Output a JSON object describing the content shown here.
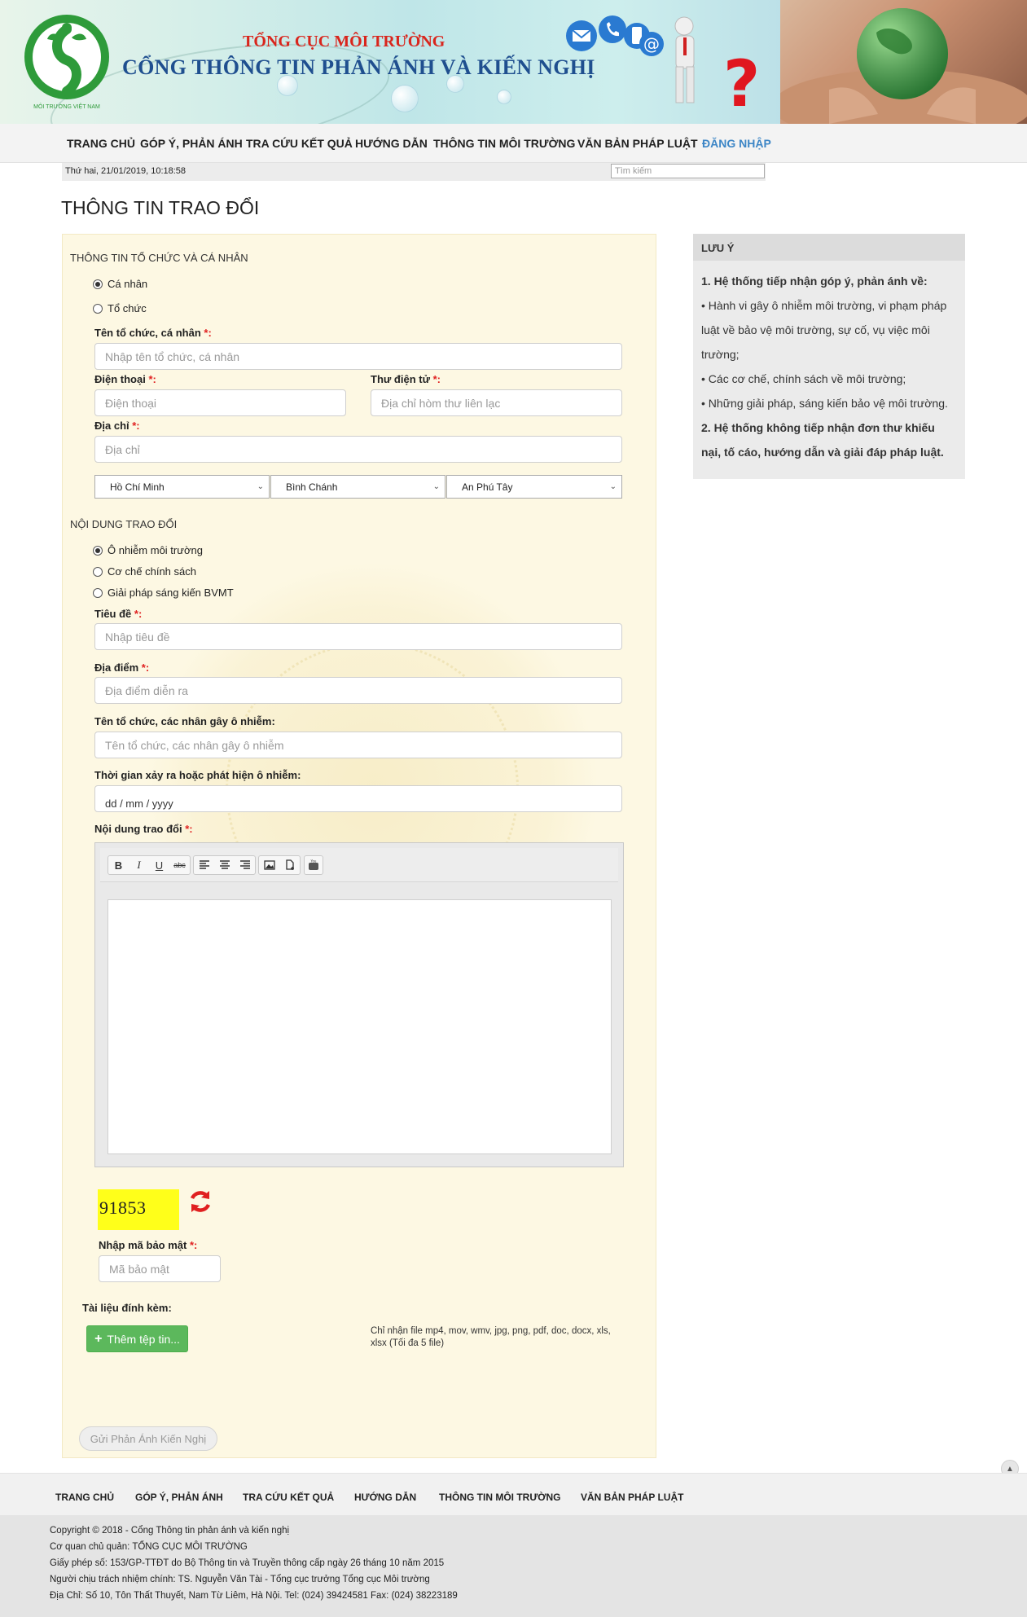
{
  "header": {
    "agency": "TỔNG CỤC MÔI TRƯỜNG",
    "portal_title": "CỔNG THÔNG TIN PHẢN ÁNH VÀ KIẾN NGHỊ",
    "logo_caption": "MÔI TRƯỜNG VIỆT NAM"
  },
  "nav": {
    "items": [
      "TRANG CHỦ",
      "GÓP Ý, PHẢN ÁNH",
      "TRA CỨU KẾT QUẢ",
      "HƯỚNG DẪN",
      "THÔNG TIN MÔI TRƯỜNG",
      "VĂN BẢN PHÁP LUẬT",
      "ĐĂNG NHẬP"
    ]
  },
  "datebar": {
    "date": "Thứ hai, 21/01/2019, 10:18:58",
    "search_placeholder": "Tìm kiếm"
  },
  "page_title": "THÔNG TIN TRAO ĐỔI",
  "form": {
    "section1": "THÔNG TIN TỔ CHỨC VÀ CÁ NHÂN",
    "type_options": [
      {
        "label": "Cá nhân",
        "selected": true
      },
      {
        "label": "Tổ chức",
        "selected": false
      }
    ],
    "name_label": "Tên tổ chức, cá nhân ",
    "name_placeholder": "Nhập tên tổ chức, cá nhân",
    "phone_label": "Điện thoại ",
    "phone_placeholder": "Điện thoại",
    "email_label": "Thư điện tử ",
    "email_placeholder": "Địa chỉ hòm thư liên lạc",
    "address_label": "Địa chỉ ",
    "address_placeholder": "Địa chỉ",
    "province": "Hồ Chí Minh",
    "district": "Bình Chánh",
    "ward": "An Phú Tây",
    "required_mark": "*:",
    "section2": "NỘI DUNG TRAO ĐỔI",
    "topic_options": [
      {
        "label": "Ô nhiễm môi trường",
        "selected": true
      },
      {
        "label": "Cơ chế chính sách",
        "selected": false
      },
      {
        "label": "Giải pháp sáng kiến BVMT",
        "selected": false
      }
    ],
    "title_label": "Tiêu đề ",
    "title_placeholder": "Nhập tiêu đề",
    "place_label": "Địa điểm ",
    "place_placeholder": "Địa điểm diễn ra",
    "polluter_label": "Tên tổ chức, các nhân gây ô nhiễm:",
    "polluter_placeholder": "Tên tổ chức, các nhân gây ô nhiễm",
    "time_label": "Thời gian xảy ra hoặc phát hiện ô nhiễm:",
    "time_value": "dd / mm / yyyy",
    "content_label": "Nội dung trao đổi ",
    "editor_tools": [
      "B",
      "I",
      "U",
      "abc"
    ],
    "captcha": "91853",
    "captcha_label": "Nhập mã bảo mật ",
    "captcha_placeholder": "Mã bảo mật",
    "attach_label": "Tài liệu đính kèm:",
    "add_file": "Thêm tệp tin...",
    "file_note": "Chỉ nhận file mp4, mov, wmv, jpg, png, pdf, doc, docx, xls, xlsx (Tối đa 5 file)",
    "submit": "Gửi Phản Ánh Kiến Nghị"
  },
  "note": {
    "title": "LƯU Ý",
    "p1": "1. Hệ thống tiếp nhận góp ý, phản ánh về:",
    "b1": "• Hành vi gây ô nhiễm môi trường, vi phạm pháp luật về bảo vệ môi trường, sự cố, vụ việc môi trường;",
    "b2": "• Các cơ chế, chính sách về môi trường;",
    "b3": "• Những giải pháp, sáng kiến bảo vệ môi trường.",
    "p2": "2. Hệ thống không tiếp nhận đơn thư khiếu nại, tố cáo, hướng dẫn và giải đáp pháp luật."
  },
  "footer": {
    "nav": [
      "TRANG CHỦ",
      "GÓP Ý, PHẢN ÁNH",
      "TRA CỨU KẾT QUẢ",
      "HƯỚNG DẪN",
      "THÔNG TIN MÔI TRƯỜNG",
      "VĂN BẢN PHÁP LUẬT"
    ],
    "lines": [
      "Copyright © 2018 - Cổng Thông tin phản ánh và kiến nghị",
      "Cơ quan chủ quản: TỔNG CỤC MÔI TRƯỜNG",
      "Giấy phép số: 153/GP-TTĐT do Bộ Thông tin và Truyền thông cấp ngày 26 tháng 10 năm 2015",
      "Người chịu trách nhiệm chính: TS. Nguyễn Văn Tài - Tổng cục trưởng Tổng cục Môi trường",
      "Địa Chỉ: Số 10, Tôn Thất Thuyết, Nam Từ Liêm, Hà Nội. Tel: (024) 39424581 Fax: (024) 38223189"
    ]
  },
  "colors": {
    "accent": "#3d86c6",
    "form_bg": "#fdf8e3",
    "required": "#e02020",
    "captcha_bg": "#ffff1a",
    "add_button": "#5cb85c"
  }
}
